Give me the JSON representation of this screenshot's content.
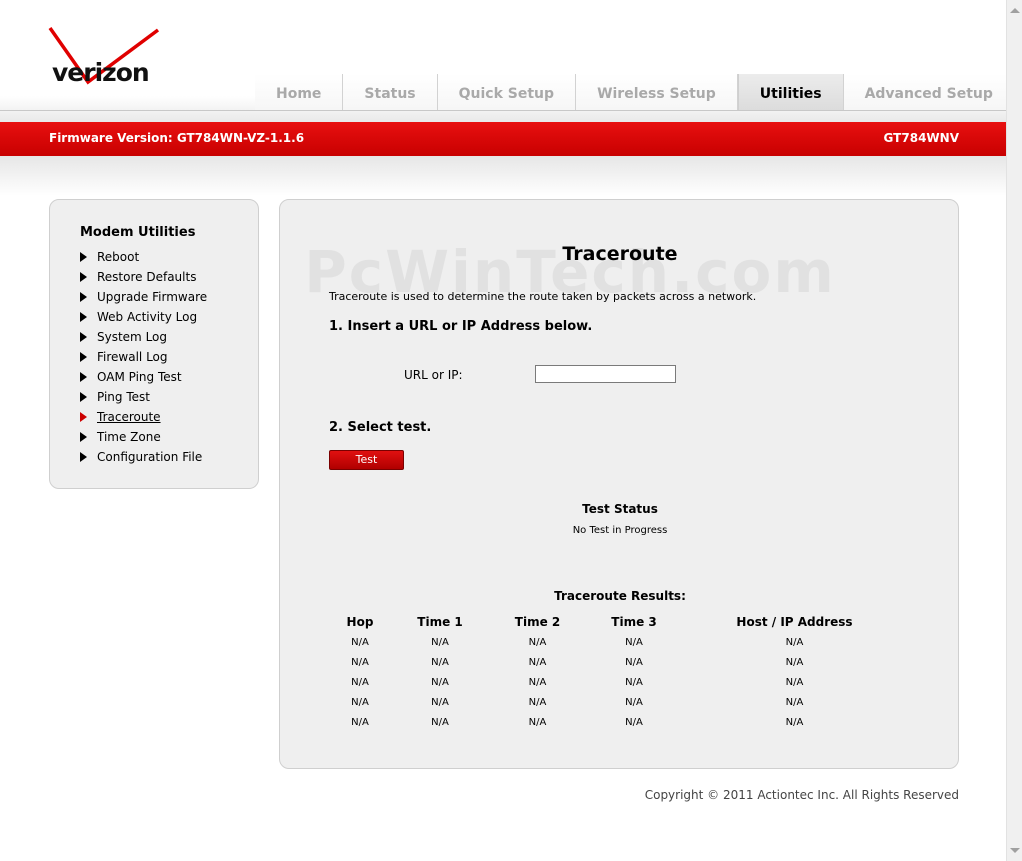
{
  "brand": {
    "logo_text": "verizon",
    "accent": "#e00000"
  },
  "tabs": [
    {
      "label": "Home",
      "active": false
    },
    {
      "label": "Status",
      "active": false
    },
    {
      "label": "Quick Setup",
      "active": false
    },
    {
      "label": "Wireless Setup",
      "active": false
    },
    {
      "label": "Utilities",
      "active": true
    },
    {
      "label": "Advanced Setup",
      "active": false
    }
  ],
  "banner": {
    "firmware": "Firmware Version: GT784WN-VZ-1.1.6",
    "model": "GT784WNV"
  },
  "sidebar": {
    "title": "Modem Utilities",
    "items": [
      {
        "label": "Reboot"
      },
      {
        "label": "Restore Defaults"
      },
      {
        "label": "Upgrade Firmware"
      },
      {
        "label": "Web Activity Log"
      },
      {
        "label": "System Log"
      },
      {
        "label": "Firewall Log"
      },
      {
        "label": "OAM Ping Test"
      },
      {
        "label": "Ping Test"
      },
      {
        "label": "Traceroute",
        "current": true
      },
      {
        "label": "Time Zone"
      },
      {
        "label": "Configuration File"
      }
    ]
  },
  "main": {
    "watermark": "PcWinTech.com",
    "title": "Traceroute",
    "description": "Traceroute is used to determine the route taken by packets across a network.",
    "step1": "1. Insert a URL or IP Address below.",
    "url_label": "URL or IP:",
    "url_value": "",
    "step2": "2. Select test.",
    "test_button": "Test",
    "status_title": "Test Status",
    "status_value": "No Test in Progress",
    "results_title": "Traceroute Results:",
    "columns": [
      "Hop",
      "Time 1",
      "Time 2",
      "Time 3",
      "Host / IP Address"
    ],
    "rows": [
      [
        "N/A",
        "N/A",
        "N/A",
        "N/A",
        "N/A"
      ],
      [
        "N/A",
        "N/A",
        "N/A",
        "N/A",
        "N/A"
      ],
      [
        "N/A",
        "N/A",
        "N/A",
        "N/A",
        "N/A"
      ],
      [
        "N/A",
        "N/A",
        "N/A",
        "N/A",
        "N/A"
      ],
      [
        "N/A",
        "N/A",
        "N/A",
        "N/A",
        "N/A"
      ]
    ]
  },
  "footer": {
    "copyright": "Copyright © 2011 Actiontec Inc. All Rights Reserved"
  }
}
